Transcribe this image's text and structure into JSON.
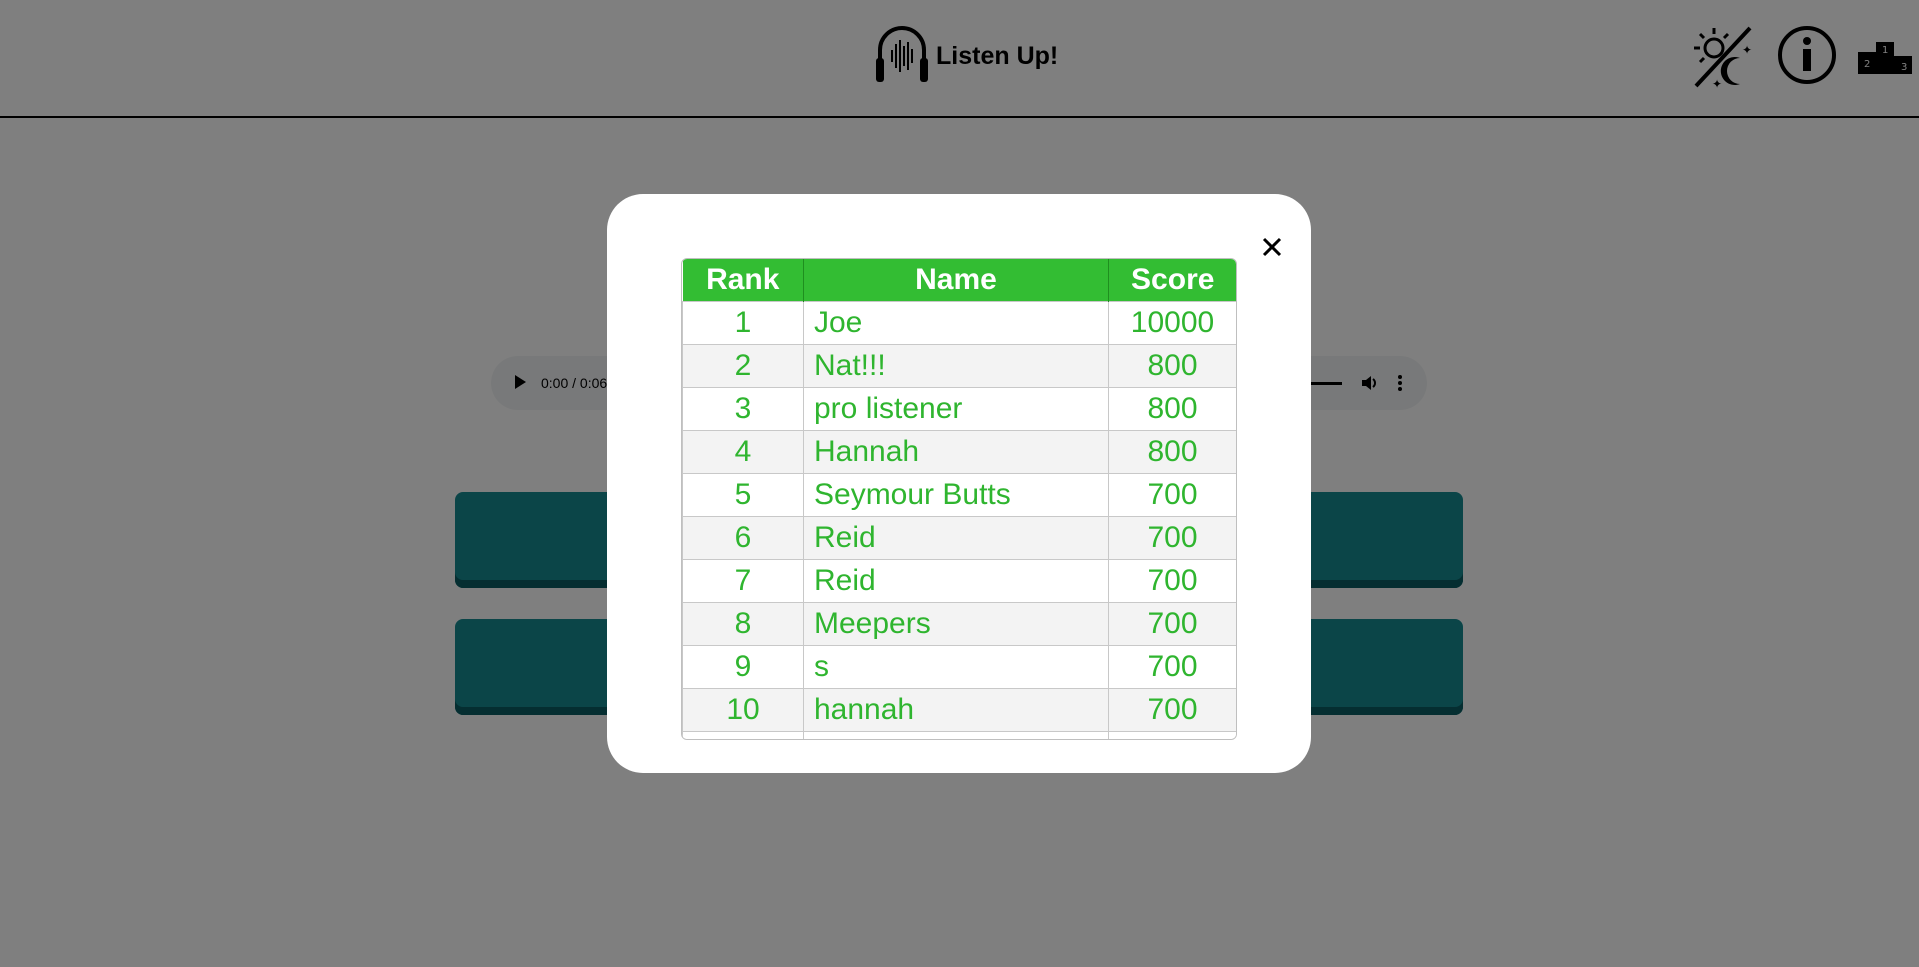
{
  "header": {
    "title": "Listen Up!",
    "icons": [
      "headphones-icon",
      "theme-toggle-icon",
      "info-icon",
      "leaderboard-podium-icon"
    ],
    "podium_labels": [
      "2",
      "1",
      "3"
    ]
  },
  "audio": {
    "time": "0:00 / 0:06"
  },
  "leaderboard": {
    "columns": [
      "Rank",
      "Name",
      "Score"
    ],
    "rows": [
      {
        "rank": "1",
        "name": "Joe",
        "score": "10000"
      },
      {
        "rank": "2",
        "name": "Nat!!!",
        "score": "800"
      },
      {
        "rank": "3",
        "name": "pro listener",
        "score": "800"
      },
      {
        "rank": "4",
        "name": "Hannah",
        "score": "800"
      },
      {
        "rank": "5",
        "name": "Seymour Butts",
        "score": "700"
      },
      {
        "rank": "6",
        "name": "Reid",
        "score": "700"
      },
      {
        "rank": "7",
        "name": "Reid",
        "score": "700"
      },
      {
        "rank": "8",
        "name": "Meepers",
        "score": "700"
      },
      {
        "rank": "9",
        "name": "s",
        "score": "700"
      },
      {
        "rank": "10",
        "name": "hannah",
        "score": "700"
      },
      {
        "rank": "",
        "name": "",
        "score": ""
      }
    ]
  },
  "colors": {
    "header_bg": "#ffffff",
    "table_header_bg": "#33bd33",
    "table_text": "#2fb52f",
    "answer_button": "#168a91",
    "overlay": "rgba(0,0,0,0.5)"
  }
}
